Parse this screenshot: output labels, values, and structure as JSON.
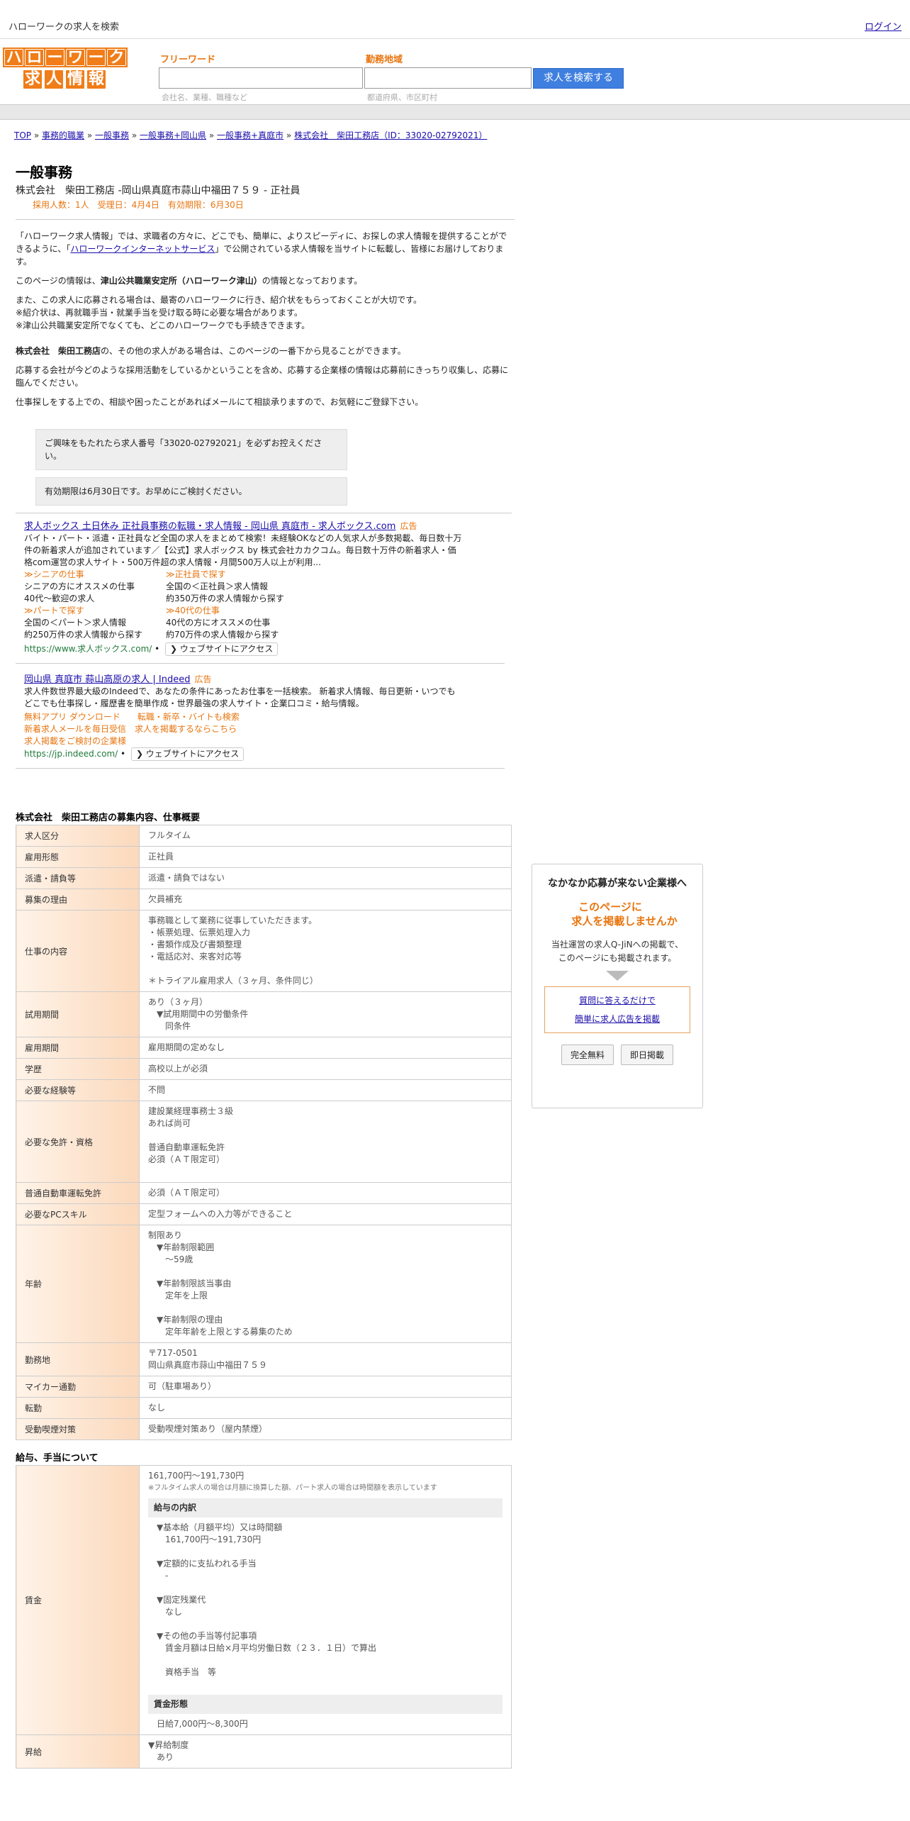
{
  "topbar": {
    "title": "ハローワークの求人を検索",
    "login": "ログイン"
  },
  "logo": {
    "row1": [
      "ハ",
      "ロ",
      "ー",
      "ワ",
      "ー",
      "ク"
    ],
    "row2": [
      "求",
      "人",
      "情",
      "報"
    ]
  },
  "search": {
    "keyword_label": "フリーワード",
    "keyword_placeholder": "会社名、業種、職種など",
    "area_label": "勤務地域",
    "area_placeholder": "都道府県、市区町村",
    "button": "求人を検索する"
  },
  "breadcrumb": [
    "TOP",
    "事務的職業",
    "一般事務",
    "一般事務+岡山県",
    "一般事務+真庭市",
    "株式会社　柴田工務店（ID：33020-02792021）"
  ],
  "job": {
    "title": "一般事務",
    "subtitle": "株式会社　柴田工務店 -岡山県真庭市蒜山中福田７５９ - 正社員",
    "meta": "採用人数：1人　受理日：4月4日　有効期限：6月30日"
  },
  "intro": {
    "p1a": "「ハローワーク求人情報」では、求職者の方々に、どこでも、簡単に、よりスピーディに、お探しの求人情報を提供することができるように、「",
    "p1link": "ハローワークインターネットサービス",
    "p1b": "」で公開されている求人情報を当サイトに転載し、皆様にお届けしております。",
    "p2a": "このページの情報は、",
    "p2b": "津山公共職業安定所（ハローワーク津山）",
    "p2c": "の情報となっております。",
    "p3": [
      "また、この求人に応募される場合は、最寄のハローワークに行き、紹介状をもらっておくことが大切です。",
      "※紹介状は、再就職手当・就業手当を受け取る時に必要な場合があります。",
      "※津山公共職業安定所でなくても、どこのハローワークでも手続きできます。"
    ],
    "p4a": "株式会社　柴田工務店",
    "p4b": "の、その他の求人がある場合は、このページの一番下から見ることができます。",
    "p5": "応募する会社が今どのような採用活動をしているかということを含め、応募する企業様の情報は応募前にきっちり収集し、応募に臨んでください。",
    "p6": "仕事探しをする上での、相談や困ったことがあればメールにて相談承りますので、お気軽にご登録下さい。",
    "box1": "ご興味をもたれたら求人番号「33020-02792021」を必ずお控えください。",
    "box2": "有効期限は6月30日です。お早めにご検討ください。"
  },
  "ads": [
    {
      "title": "求人ボックス 土日休み 正社員事務の転職・求人情報 - 岡山県 真庭市 - 求人ボックス.com",
      "tag": "広告",
      "desc": "バイト・パート・派遣・正社員など全国の求人をまとめて検索！未経験OKなどの人気求人が多数掲載、毎日数十万件の新着求人が追加されています／【公式】求人ボックス by 株式会社カカクコム。毎日数十万件の新着求人・価格com運営の求人サイト・500万件超の求人情報・月間500万人以上が利用...",
      "links": [
        {
          "head": "≫シニアの仕事",
          "l1": "シニアの方にオススメの仕事",
          "l2": "40代～歓迎の求人"
        },
        {
          "head": "≫正社員で探す",
          "l1": "全国の＜正社員＞求人情報",
          "l2": "約350万件の求人情報から探す"
        },
        {
          "head": "≫パートで探す",
          "l1": "全国の＜パート＞求人情報",
          "l2": "約250万件の求人情報から探す"
        },
        {
          "head": "≫40代の仕事",
          "l1": "40代の方にオススメの仕事",
          "l2": "約70万件の求人情報から探す"
        }
      ],
      "url": "https://www.求人ボックス.com/",
      "visit": "❯ ウェブサイトにアクセス"
    },
    {
      "title": "岡山県 真庭市 蒜山高原の求人 | Indeed",
      "tag": "広告",
      "desc": "求人件数世界最大級のIndeedで、あなたの条件にあったお仕事を一括検索。 新着求人情報、毎日更新・いつでもどこでも仕事探し・履歴書を簡単作成・世界最強の求人サイト・企業口コミ・給与情報。",
      "sitelinks": [
        "無料アプリ ダウンロード",
        "転職・新卒・バイトも検索",
        "新着求人メールを毎日受信",
        "求人を掲載するならこちら",
        "求人掲載をご検討の企業様"
      ],
      "url": "https://jp.indeed.com/",
      "visit": "❯ ウェブサイトにアクセス"
    }
  ],
  "recruit": {
    "heading": "株式会社　柴田工務店の募集内容、仕事概要",
    "rows": [
      {
        "k": "求人区分",
        "v": [
          "フルタイム"
        ]
      },
      {
        "k": "雇用形態",
        "v": [
          "正社員"
        ]
      },
      {
        "k": "派遣・請負等",
        "v": [
          "派遣・請負ではない"
        ]
      },
      {
        "k": "募集の理由",
        "v": [
          "欠員補充"
        ]
      },
      {
        "k": "仕事の内容",
        "v": [
          "事務職として業務に従事していただきます。",
          "・帳票処理、伝票処理入力",
          "・書類作成及び書類整理",
          "・電話応対、来客対応等",
          "",
          "＊トライアル雇用求人（３ヶ月、条件同じ）"
        ]
      },
      {
        "k": "試用期間",
        "v": [
          "あり（３ヶ月）",
          "　▼試用期間中の労働条件",
          "　　同条件"
        ]
      },
      {
        "k": "雇用期間",
        "v": [
          "雇用期間の定めなし"
        ]
      },
      {
        "k": "学歴",
        "v": [
          "高校以上が必須"
        ]
      },
      {
        "k": "必要な経験等",
        "v": [
          "不問"
        ]
      },
      {
        "k": "必要な免許・資格",
        "v": [
          "建設業経理事務士３級",
          "あれば尚可",
          "",
          "普通自動車運転免許",
          "必須（ＡＴ限定可）",
          ""
        ]
      },
      {
        "k": "普通自動車運転免許",
        "v": [
          "必須（ＡＴ限定可）"
        ]
      },
      {
        "k": "必要なPCスキル",
        "v": [
          "定型フォームへの入力等ができること"
        ]
      },
      {
        "k": "年齢",
        "v": [
          "制限あり",
          "　▼年齢制限範囲",
          "　　〜59歳",
          "",
          "　▼年齢制限該当事由",
          "　　定年を上限",
          "",
          "　▼年齢制限の理由",
          "　　定年年齢を上限とする募集のため"
        ]
      },
      {
        "k": "勤務地",
        "v": [
          "〒717-0501",
          "岡山県真庭市蒜山中福田７５９"
        ]
      },
      {
        "k": "マイカー通勤",
        "v": [
          "可（駐車場あり）"
        ]
      },
      {
        "k": "転勤",
        "v": [
          "なし"
        ]
      },
      {
        "k": "受動喫煙対策",
        "v": [
          "受動喫煙対策あり（屋内禁煙）"
        ]
      }
    ]
  },
  "salary": {
    "heading": "給与、手当について",
    "wage_label": "賃金",
    "range": "161,700円〜191,730円",
    "note": "※フルタイム求人の場合は月額に換算した額、パート求人の場合は時間額を表示しています",
    "breakdown_head": "給与の内訳",
    "items": [
      {
        "h": "▼基本給（月額平均）又は時間額",
        "v": "161,700円〜191,730円"
      },
      {
        "h": "▼定額的に支払われる手当",
        "v": "-"
      },
      {
        "h": "▼固定残業代",
        "v": "なし"
      },
      {
        "h": "▼その他の手当等付記事項",
        "v": "賃金月額は日給×月平均労働日数（２３．１日）で算出\n\n資格手当　等"
      }
    ],
    "form_head": "賃金形態",
    "form": "日給7,000円〜8,300円",
    "raise_label": "昇給",
    "raise": [
      "▼昇給制度",
      "あり"
    ]
  },
  "side": {
    "heading": "なかなか応募が来ない企業様へ",
    "offer1": "このページに",
    "offer2": "求人を掲載しませんか",
    "desc1": "当社運営の求人Q-JiNへの掲載で、",
    "desc2": "このページにも掲載されます。",
    "link1": "質問に答えるだけで",
    "link2": "簡単に求人広告を掲載",
    "btn1": "完全無料",
    "btn2": "即日掲載"
  }
}
